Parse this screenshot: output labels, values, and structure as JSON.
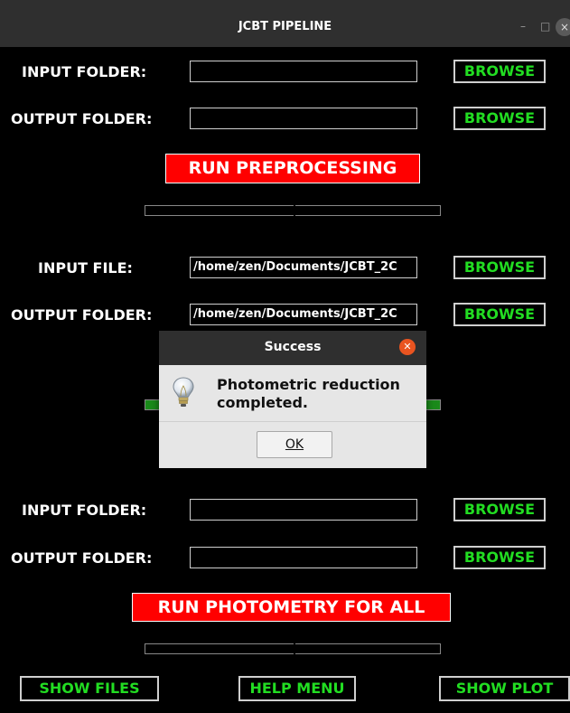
{
  "window": {
    "title": "JCBT PIPELINE",
    "minimize_glyph": "–",
    "maximize_glyph": "□",
    "close_glyph": "×"
  },
  "section1": {
    "input_label": "INPUT FOLDER:",
    "input_value": "",
    "output_label": "OUTPUT FOLDER:",
    "output_value": "",
    "browse_label": "BROWSE",
    "run_label": "RUN PREPROCESSING",
    "progress": 0
  },
  "section2": {
    "input_label": "INPUT FILE:",
    "input_value": "/home/zen/Documents/JCBT_2C",
    "output_label": "OUTPUT FOLDER:",
    "output_value": "/home/zen/Documents/JCBT_2C",
    "browse_label": "BROWSE",
    "progress": 1.0
  },
  "section3": {
    "input_label": "INPUT FOLDER:",
    "input_value": "",
    "output_label": "OUTPUT FOLDER:",
    "output_value": "",
    "browse_label": "BROWSE",
    "run_label": "RUN PHOTOMETRY FOR ALL",
    "progress": 0
  },
  "bottom": {
    "show_files": "SHOW FILES",
    "help_menu": "HELP MENU",
    "show_plot": "SHOW PLOT"
  },
  "dialog": {
    "title": "Success",
    "message": "Photometric reduction completed.",
    "ok_label": "OK",
    "icon": "lightbulb-info-icon"
  },
  "colors": {
    "background": "#000000",
    "accent_green": "#22dd22",
    "run_button_red": "#ff0000",
    "dialog_close": "#e95420",
    "progress_fill": "#1a8a1a"
  }
}
